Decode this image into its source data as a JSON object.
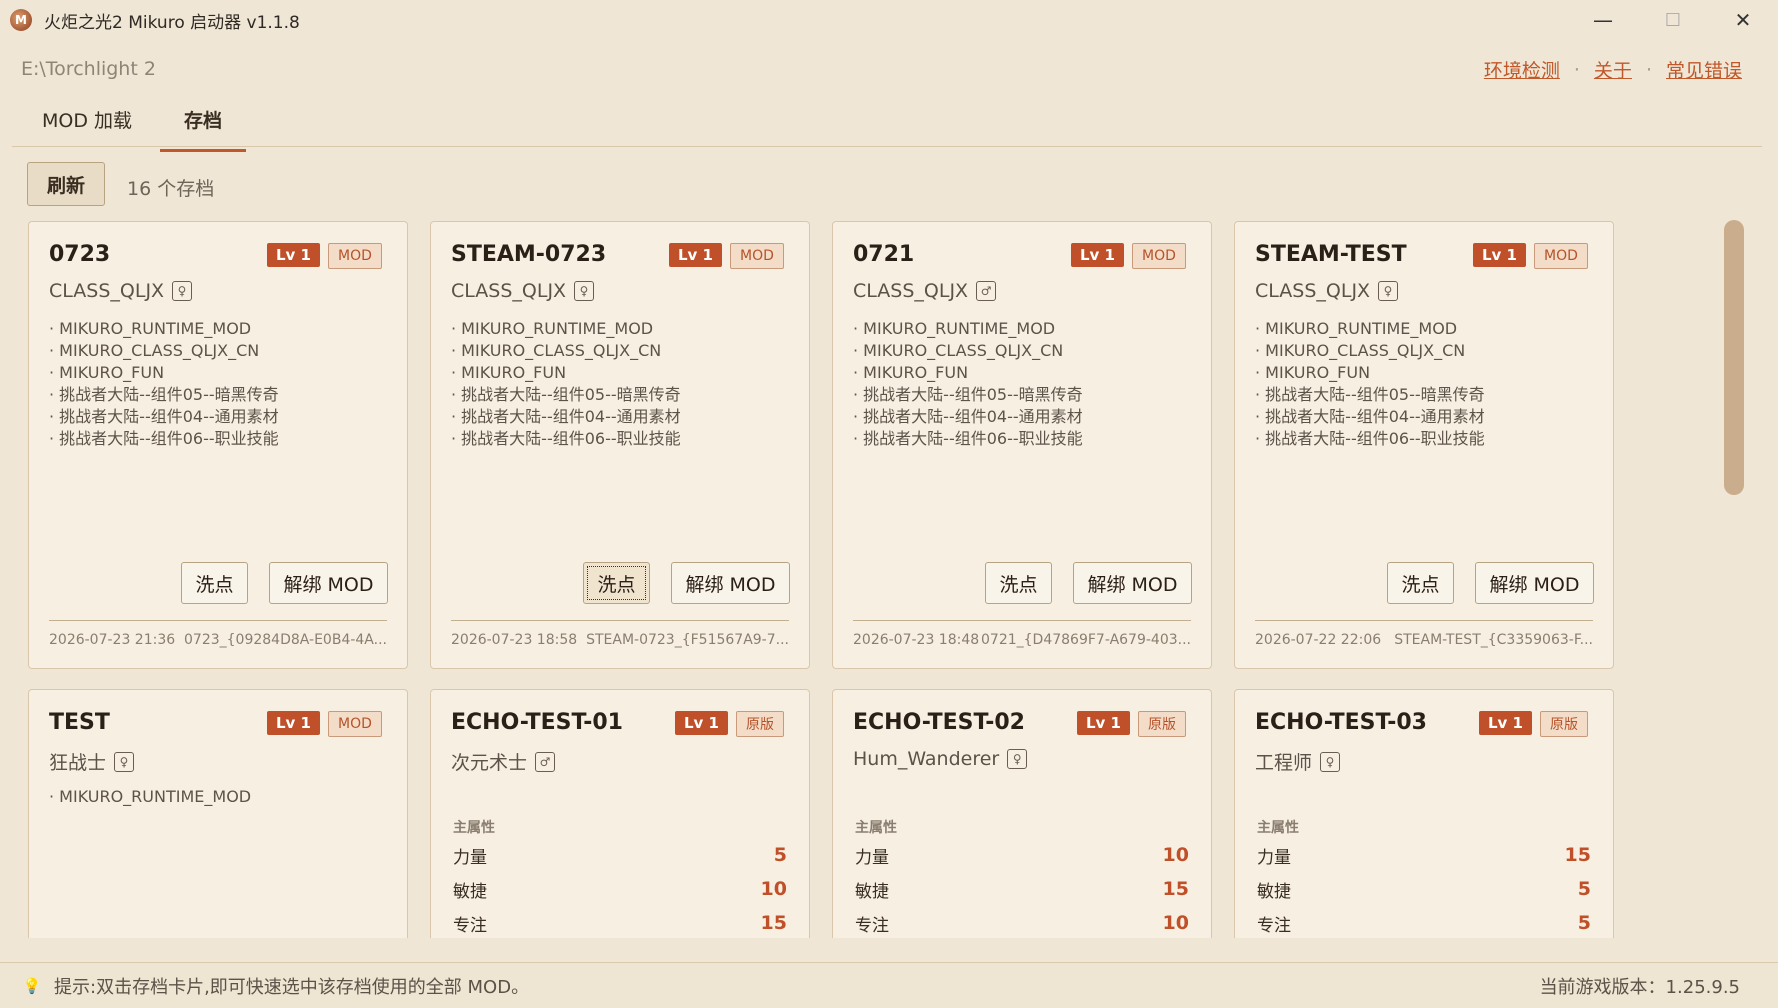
{
  "window": {
    "title": "火炬之光2 Mikuro 启动器   v1.1.8",
    "minimize": "—",
    "maximize": "☐",
    "close": "✕"
  },
  "path": "E:\\Torchlight 2",
  "links": [
    "环境检测",
    "关于",
    "常见错误"
  ],
  "link_separator": "·",
  "tabs": [
    "MOD 加载",
    "存档"
  ],
  "active_tab": "存档",
  "toolbar": {
    "refresh_label": "刷新",
    "count_label": "16 个存档"
  },
  "cards": [
    {
      "name": "0723",
      "level": "Lv 1",
      "badge": "MOD",
      "class": "CLASS_QLJX",
      "gender_icon": "female-icon",
      "mods": [
        "· MIKURO_RUNTIME_MOD",
        "· MIKURO_CLASS_QLJX_CN",
        "· MIKURO_FUN",
        "· 挑战者大陆--组件05--暗黑传奇",
        "· 挑战者大陆--组件04--通用素材",
        "· 挑战者大陆--组件06--职业技能"
      ],
      "btn_respec": "洗点",
      "btn_unbind": "解绑 MOD",
      "date": "2026-07-23 21:36",
      "id": "0723_{09284D8A-E0B4-4A..."
    },
    {
      "name": "STEAM-0723",
      "level": "Lv 1",
      "badge": "MOD",
      "class": "CLASS_QLJX",
      "gender_icon": "female-icon",
      "mods": [
        "· MIKURO_RUNTIME_MOD",
        "· MIKURO_CLASS_QLJX_CN",
        "· MIKURO_FUN",
        "· 挑战者大陆--组件05--暗黑传奇",
        "· 挑战者大陆--组件04--通用素材",
        "· 挑战者大陆--组件06--职业技能"
      ],
      "btn_respec": "洗点",
      "btn_unbind": "解绑 MOD",
      "date": "2026-07-23 18:58",
      "id": "STEAM-0723_{F51567A9-7..."
    },
    {
      "name": "0721",
      "level": "Lv 1",
      "badge": "MOD",
      "class": "CLASS_QLJX",
      "gender_icon": "male-icon",
      "mods": [
        "· MIKURO_RUNTIME_MOD",
        "· MIKURO_CLASS_QLJX_CN",
        "· MIKURO_FUN",
        "· 挑战者大陆--组件05--暗黑传奇",
        "· 挑战者大陆--组件04--通用素材",
        "· 挑战者大陆--组件06--职业技能"
      ],
      "btn_respec": "洗点",
      "btn_unbind": "解绑 MOD",
      "date": "2026-07-23 18:48",
      "id": "0721_{D47869F7-A679-403..."
    },
    {
      "name": "STEAM-TEST",
      "level": "Lv 1",
      "badge": "MOD",
      "class": "CLASS_QLJX",
      "gender_icon": "female-icon",
      "mods": [
        "· MIKURO_RUNTIME_MOD",
        "· MIKURO_CLASS_QLJX_CN",
        "· MIKURO_FUN",
        "· 挑战者大陆--组件05--暗黑传奇",
        "· 挑战者大陆--组件04--通用素材",
        "· 挑战者大陆--组件06--职业技能"
      ],
      "btn_respec": "洗点",
      "btn_unbind": "解绑 MOD",
      "date": "2026-07-22 22:06",
      "id": "STEAM-TEST_{C3359063-F..."
    },
    {
      "name": "TEST",
      "level": "Lv 1",
      "badge": "MOD",
      "class": "狂战士",
      "gender_icon": "female-icon",
      "mods": [
        "· MIKURO_RUNTIME_MOD"
      ]
    },
    {
      "name": "ECHO-TEST-01",
      "level": "Lv 1",
      "badge": "原版",
      "class": "次元术士",
      "gender_icon": "male-icon",
      "stats_title": "主属性",
      "stats": [
        {
          "label": "力量",
          "value": "5"
        },
        {
          "label": "敏捷",
          "value": "10"
        },
        {
          "label": "专注",
          "value": "15"
        }
      ]
    },
    {
      "name": "ECHO-TEST-02",
      "level": "Lv 1",
      "badge": "原版",
      "class": "Hum_Wanderer",
      "gender_icon": "female-icon",
      "stats_title": "主属性",
      "stats": [
        {
          "label": "力量",
          "value": "10"
        },
        {
          "label": "敏捷",
          "value": "15"
        },
        {
          "label": "专注",
          "value": "10"
        }
      ]
    },
    {
      "name": "ECHO-TEST-03",
      "level": "Lv 1",
      "badge": "原版",
      "class": "工程师",
      "gender_icon": "female-icon",
      "stats_title": "主属性",
      "stats": [
        {
          "label": "力量",
          "value": "15"
        },
        {
          "label": "敏捷",
          "value": "5"
        },
        {
          "label": "专注",
          "value": "5"
        }
      ]
    }
  ],
  "status": {
    "hint": "提示:双击存档卡片,即可快速选中该存档使用的全部 MOD。",
    "version": "当前游戏版本：1.25.9.5"
  }
}
